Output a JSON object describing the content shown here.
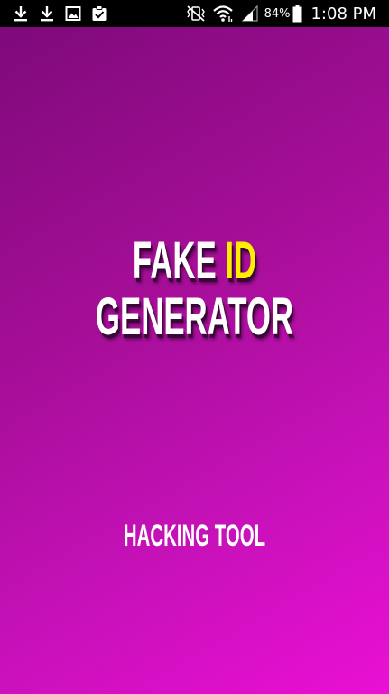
{
  "status_bar": {
    "left_icons": [
      "download-icon",
      "download-icon",
      "image-icon",
      "clipboard-check-icon"
    ],
    "right_icons": [
      "vibrate-mute-icon",
      "wifi-icon",
      "signal-icon",
      "battery-icon"
    ],
    "battery_percent": "84%",
    "time": "1:08 PM"
  },
  "splash": {
    "title_word1": "FAKE",
    "title_highlight": "ID",
    "title_line2": "GENERATOR",
    "tagline": "HACKING TOOL",
    "colors": {
      "gradient_start": "#7e0a7a",
      "gradient_end": "#ea10d4",
      "title_text": "#ffffff",
      "highlight_text": "#ffee00"
    }
  }
}
